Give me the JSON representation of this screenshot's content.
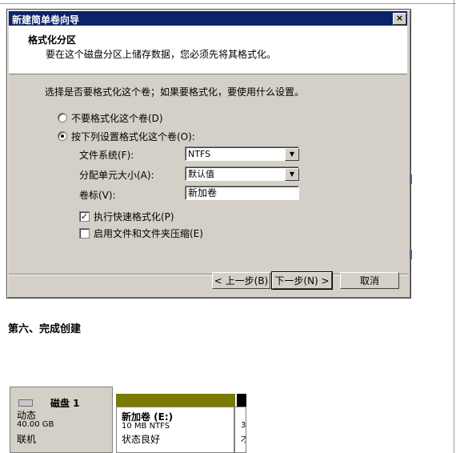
{
  "dialog": {
    "title": "新建简单卷向导",
    "close_glyph": "×",
    "header_title": "格式化分区",
    "header_subtitle": "要在这个磁盘分区上储存数据，您必须先将其格式化。",
    "instruction": "选择是否要格式化这个卷；如果要格式化，要使用什么设置。",
    "radio_no_format": "不要格式化这个卷(D)",
    "radio_format": "按下列设置格式化这个卷(O):",
    "label_filesystem": "文件系统(F):",
    "value_filesystem": "NTFS",
    "label_alloc": "分配单元大小(A):",
    "value_alloc": "默认值",
    "label_volume": "卷标(V):",
    "value_volume": "新加卷",
    "check_quick": "执行快速格式化(P)",
    "check_quick_state": true,
    "check_compress": "启用文件和文件夹压缩(E)",
    "check_compress_state": false,
    "back_button": "< 上一步(B)",
    "next_button": "下一步(N) >",
    "cancel_button": "取消",
    "dropdown_glyph": "▼",
    "check_glyph": "✓"
  },
  "section_heading": "第六、完成创建",
  "disk": {
    "name": "磁盘 1",
    "type": "动态",
    "size": "40.00 GB",
    "status": "联机",
    "volume_name": "新加卷  (E:)",
    "volume_detail": "10 MB NTFS",
    "volume_status": "状态良好",
    "next_partial_1": "3",
    "next_partial_2": "才"
  },
  "colors": {
    "title_bar": "#0a246a",
    "dialog_face": "#d4d0c8",
    "volume_header": "#7a7a00"
  }
}
